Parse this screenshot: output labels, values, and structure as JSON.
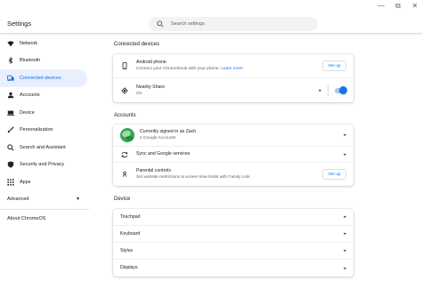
{
  "window": {
    "minimize": "—",
    "maximize": "⧉",
    "close": "✕"
  },
  "header": {
    "title": "Settings",
    "search_placeholder": "Search settings"
  },
  "sidebar": {
    "items": [
      {
        "label": "Network",
        "icon": "wifi-icon"
      },
      {
        "label": "Bluetooth",
        "icon": "bluetooth-icon"
      },
      {
        "label": "Connected devices",
        "icon": "connected-devices-icon",
        "active": true
      },
      {
        "label": "Accounts",
        "icon": "person-icon"
      },
      {
        "label": "Device",
        "icon": "laptop-icon"
      },
      {
        "label": "Personalization",
        "icon": "brush-icon"
      },
      {
        "label": "Search and Assistant",
        "icon": "search-icon"
      },
      {
        "label": "Security and Privacy",
        "icon": "shield-icon"
      },
      {
        "label": "Apps",
        "icon": "apps-grid-icon"
      }
    ],
    "advanced": "Advanced",
    "about": "About ChromeOS"
  },
  "connected": {
    "title": "Connected devices",
    "phone_title": "Android phone",
    "phone_sub": "Connect your Chromebook with your phone.",
    "phone_link": "Learn more",
    "phone_btn": "Set up",
    "share_title": "Nearby Share",
    "share_sub": "On",
    "share_enabled": true
  },
  "accounts": {
    "title": "Accounts",
    "signed_in": "Currently signed in as Zach",
    "google_accounts": "2 Google Accounts",
    "sync": "Sync and Google services",
    "parental_title": "Parental controls",
    "parental_sub": "Set website restrictions & screen time limits with Family Link",
    "parental_btn": "Set up"
  },
  "device": {
    "title": "Device",
    "items": [
      "Touchpad",
      "Keyboard",
      "Stylus",
      "Displays"
    ]
  },
  "colors": {
    "accent": "#1a73e8",
    "active_bg": "#e8f0fe",
    "active_text": "#1967d2"
  }
}
